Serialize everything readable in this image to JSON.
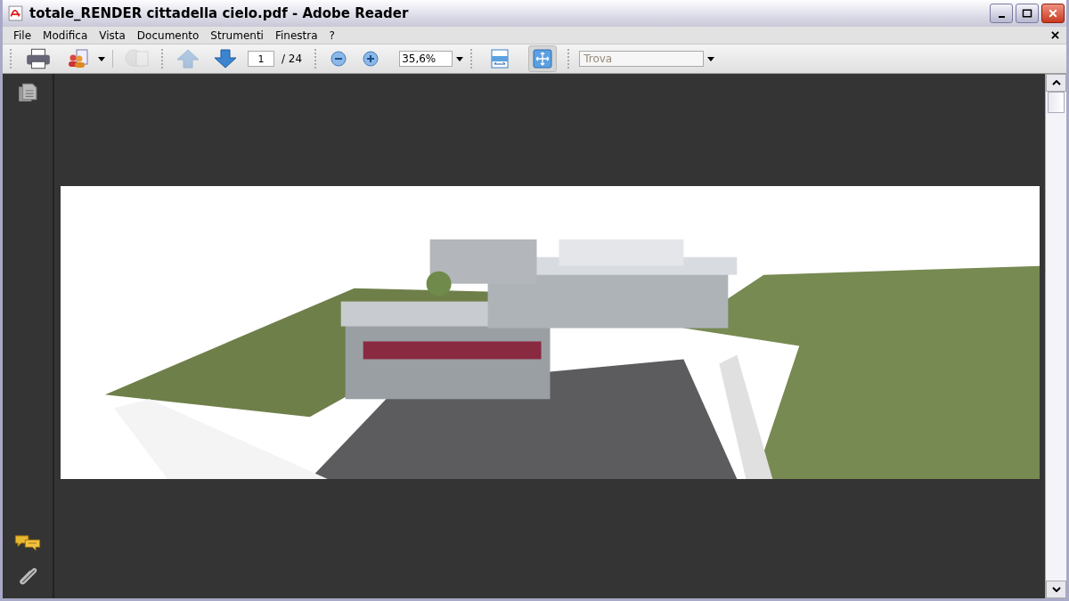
{
  "window": {
    "title": "totale_RENDER cittadella cielo.pdf - Adobe Reader"
  },
  "menu": [
    "File",
    "Modifica",
    "Vista",
    "Documento",
    "Strumenti",
    "Finestra",
    "?"
  ],
  "toolbar": {
    "print_disabled": false,
    "share_disabled": false,
    "collab_disabled": true,
    "prev_page_disabled": true,
    "next_page_disabled": false,
    "page": "1",
    "page_total": "/ 24",
    "zoom": "35,6%",
    "view_buttons": [
      {
        "kind": "fit-width",
        "selected": false
      },
      {
        "kind": "fit-page",
        "selected": true
      }
    ],
    "search": {
      "placeholder": "Trova"
    }
  }
}
